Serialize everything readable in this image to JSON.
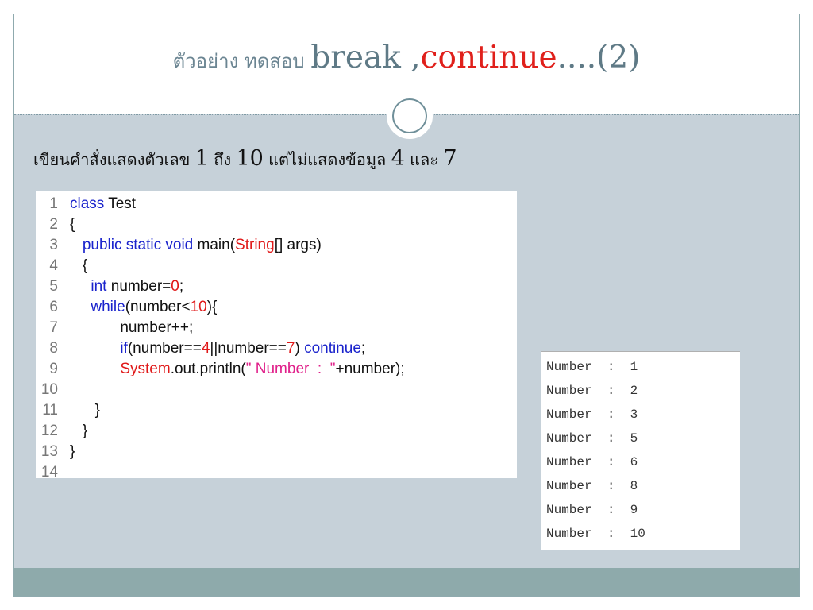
{
  "title": {
    "thai": "ตัวอย่าง ทดสอบ ",
    "part1": "break ,",
    "part2": "continue",
    "part3": "....(2)"
  },
  "instruction": {
    "text1": "เขียนคำสั่งแสดงตัวเลข ",
    "num1": "1",
    "text2": " ถึง ",
    "num2": "10",
    "text3": " แต่ไม่แสดงข้อมูล  ",
    "num3": "4",
    "text4": " และ ",
    "num4": "7"
  },
  "code": [
    {
      "n": "1",
      "parts": [
        {
          "t": "class",
          "c": "kw"
        },
        {
          "t": " Test",
          "c": "plain"
        }
      ]
    },
    {
      "n": "2",
      "parts": [
        {
          "t": "{",
          "c": "plain"
        }
      ]
    },
    {
      "n": "3",
      "parts": [
        {
          "t": "   public static void",
          "c": "kw"
        },
        {
          "t": " main(",
          "c": "plain"
        },
        {
          "t": "String",
          "c": "cls"
        },
        {
          "t": "[] args)",
          "c": "plain"
        }
      ]
    },
    {
      "n": "4",
      "parts": [
        {
          "t": "   {",
          "c": "plain"
        }
      ]
    },
    {
      "n": "5",
      "parts": [
        {
          "t": "     int",
          "c": "kw"
        },
        {
          "t": " number=",
          "c": "plain"
        },
        {
          "t": "0",
          "c": "cls"
        },
        {
          "t": ";",
          "c": "plain"
        }
      ]
    },
    {
      "n": "6",
      "parts": [
        {
          "t": "     while",
          "c": "kw"
        },
        {
          "t": "(number<",
          "c": "plain"
        },
        {
          "t": "10",
          "c": "cls"
        },
        {
          "t": "){",
          "c": "plain"
        }
      ]
    },
    {
      "n": "7",
      "parts": [
        {
          "t": "            number++;",
          "c": "plain"
        }
      ]
    },
    {
      "n": "8",
      "parts": [
        {
          "t": "            if",
          "c": "kw"
        },
        {
          "t": "(number==",
          "c": "plain"
        },
        {
          "t": "4",
          "c": "cls"
        },
        {
          "t": "||number==",
          "c": "plain"
        },
        {
          "t": "7",
          "c": "cls"
        },
        {
          "t": ") ",
          "c": "plain"
        },
        {
          "t": "continue",
          "c": "kw"
        },
        {
          "t": ";",
          "c": "plain"
        }
      ]
    },
    {
      "n": "9",
      "parts": [
        {
          "t": "            System",
          "c": "cls"
        },
        {
          "t": ".out.println(",
          "c": "plain"
        },
        {
          "t": "\" Number  :  \"",
          "c": "str"
        },
        {
          "t": "+number);",
          "c": "plain"
        }
      ]
    },
    {
      "n": "10",
      "parts": []
    },
    {
      "n": "11",
      "parts": [
        {
          "t": "      }",
          "c": "plain"
        }
      ]
    },
    {
      "n": "12",
      "parts": [
        {
          "t": "   }",
          "c": "plain"
        }
      ]
    },
    {
      "n": "13",
      "parts": [
        {
          "t": "}",
          "c": "plain"
        }
      ]
    },
    {
      "n": "14",
      "parts": []
    }
  ],
  "output": [
    "Number  :  1",
    "Number  :  2",
    "Number  :  3",
    "Number  :  5",
    "Number  :  6",
    "Number  :  8",
    "Number  :  9",
    "Number  :  10"
  ],
  "colors": {
    "accent_red": "#e0201b",
    "slide_bg": "#c6d1d9",
    "footer": "#8eaaab"
  }
}
